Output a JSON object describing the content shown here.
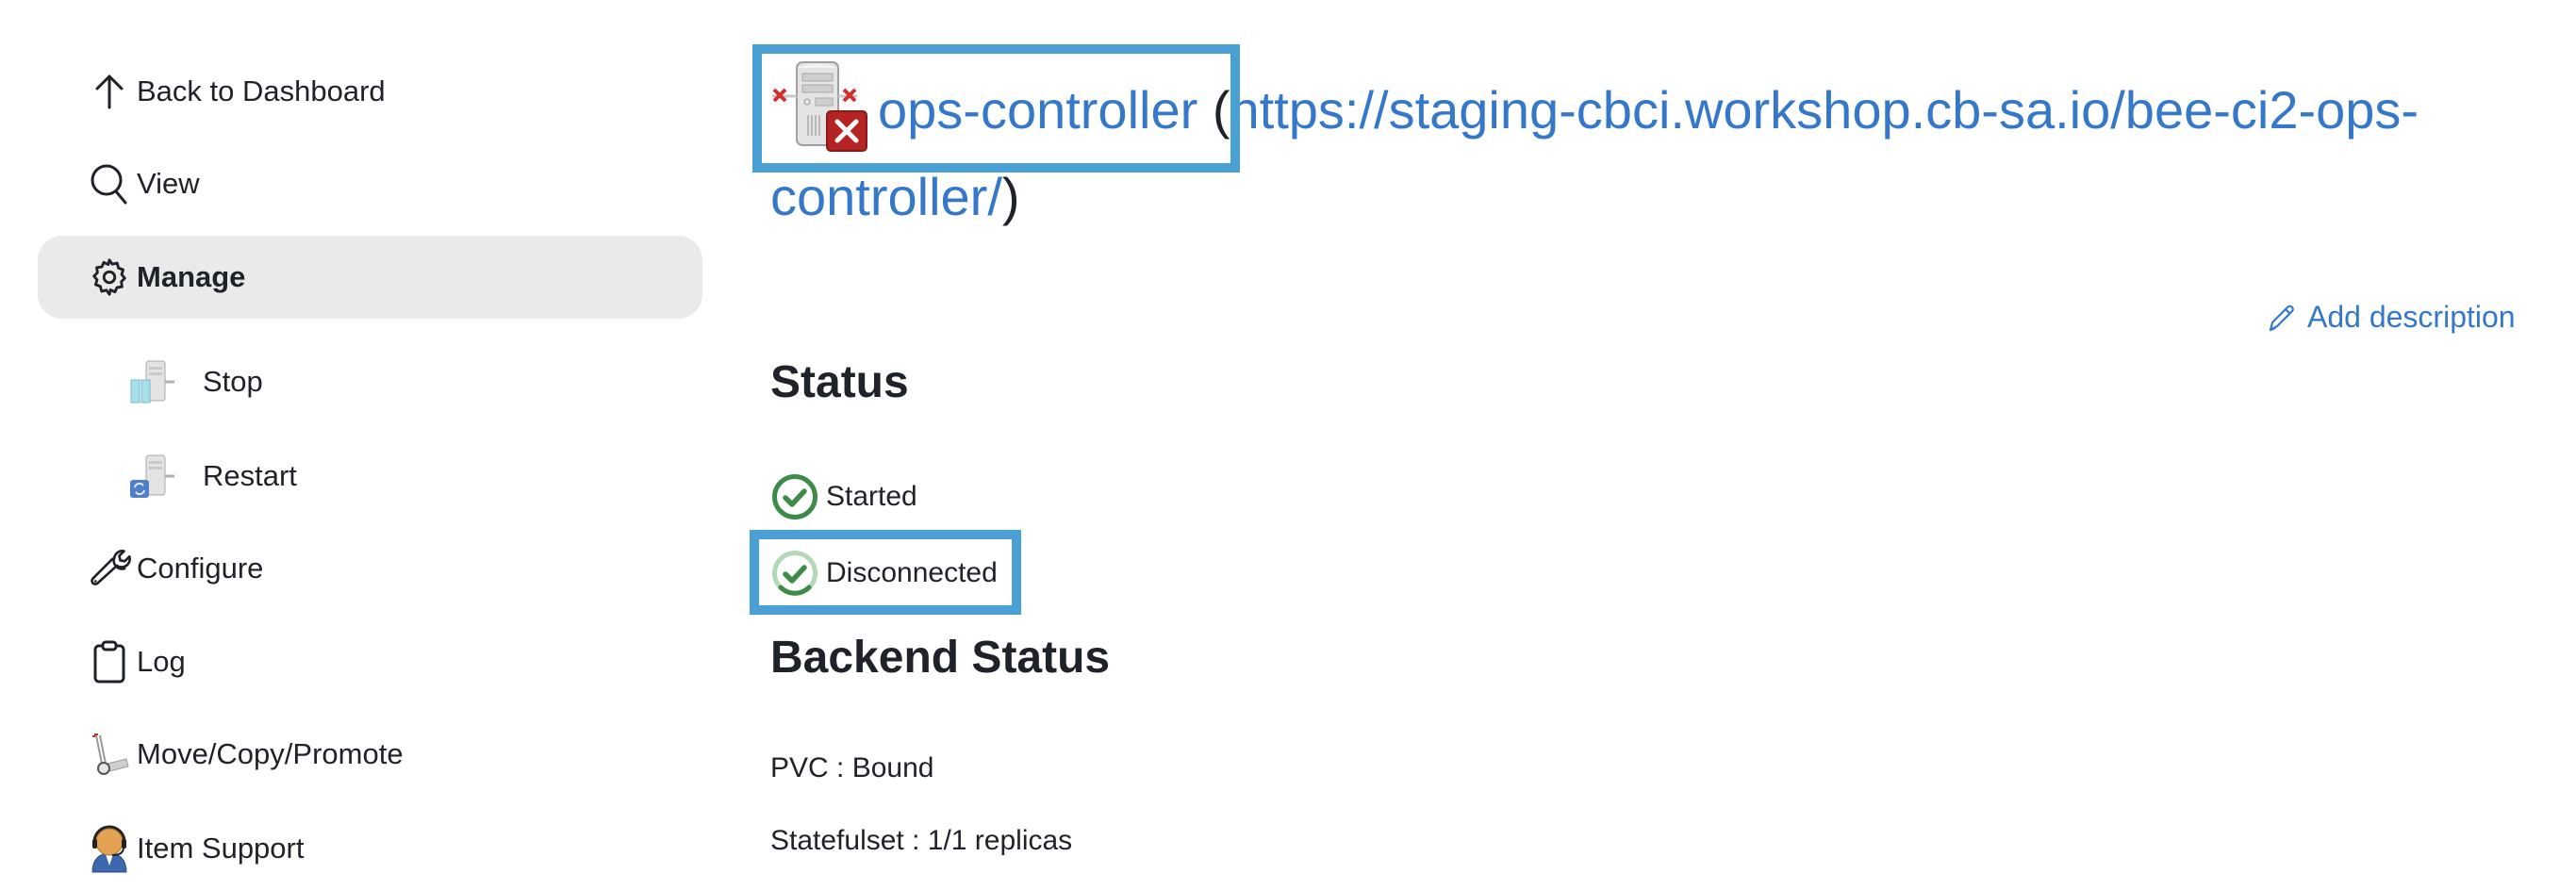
{
  "sidebar": {
    "items": [
      {
        "label": "Back to Dashboard",
        "icon": "arrow-up-icon"
      },
      {
        "label": "View",
        "icon": "search-icon"
      },
      {
        "label": "Manage",
        "icon": "gear-icon",
        "active": true
      },
      {
        "label": "Stop",
        "icon": "server-stop-icon",
        "sub": true
      },
      {
        "label": "Restart",
        "icon": "server-restart-icon",
        "sub": true
      },
      {
        "label": "Configure",
        "icon": "wrench-icon"
      },
      {
        "label": "Log",
        "icon": "clipboard-icon"
      },
      {
        "label": "Move/Copy/Promote",
        "icon": "hand-truck-icon"
      },
      {
        "label": "Item Support",
        "icon": "support-agent-icon"
      }
    ]
  },
  "header": {
    "name": "ops-controller",
    "open_paren": "(",
    "url": "https://staging-cbci.workshop.cb-sa.io/bee-ci2-ops-controller/",
    "close_paren": ")",
    "icon": "server-offline-icon"
  },
  "actions": {
    "add_description": "Add description"
  },
  "status": {
    "heading": "Status",
    "items": [
      {
        "label": "Started",
        "icon": "check-circle-icon"
      },
      {
        "label": "Disconnected",
        "icon": "check-circle-pending-icon"
      }
    ]
  },
  "backend": {
    "heading": "Backend Status",
    "pvc": "PVC : Bound",
    "statefulset": "Statefulset : 1/1 replicas"
  },
  "colors": {
    "link": "#3578c9",
    "highlight": "#4a9fd5",
    "success": "#3d8b48",
    "active_bg": "#e9eaea"
  }
}
